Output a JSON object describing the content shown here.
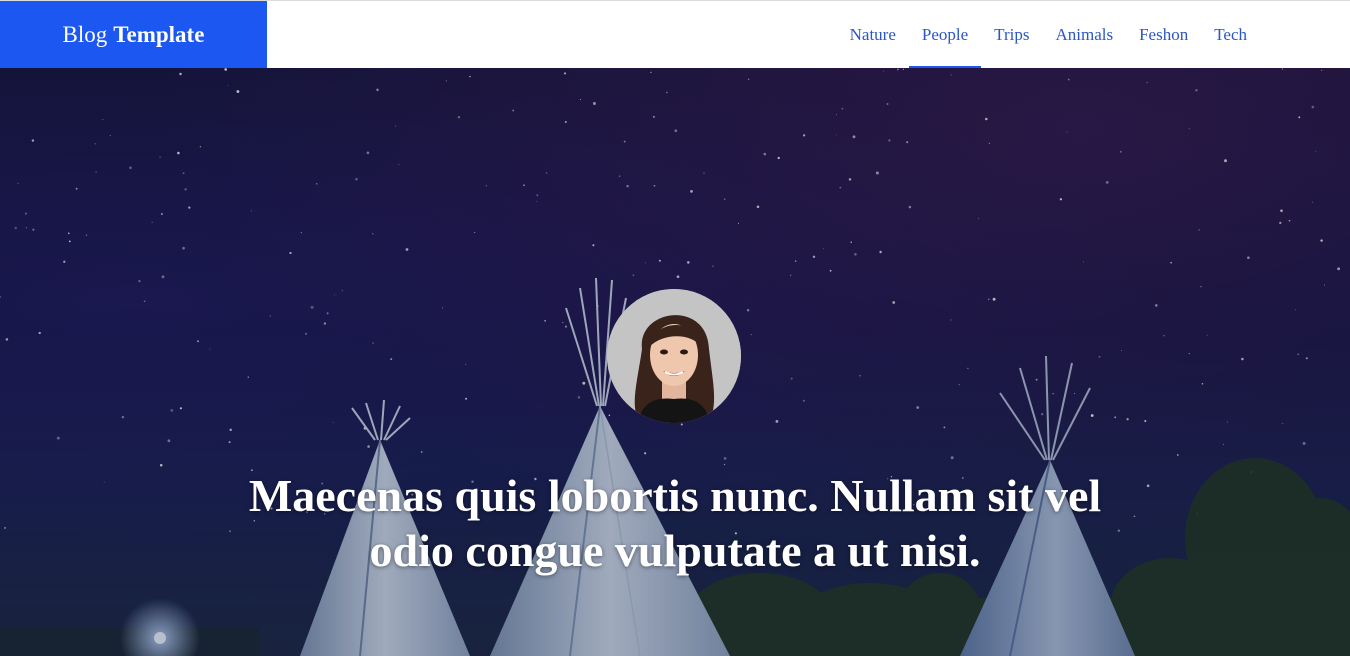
{
  "brand": {
    "part1": "Blog",
    "part2": "Template",
    "color": "#1b57f0"
  },
  "nav": {
    "items": [
      {
        "label": "Nature",
        "active": false
      },
      {
        "label": "People",
        "active": true
      },
      {
        "label": "Trips",
        "active": false
      },
      {
        "label": "Animals",
        "active": false
      },
      {
        "label": "Feshon",
        "active": false
      },
      {
        "label": "Tech",
        "active": false
      }
    ],
    "link_color": "#2a56c6"
  },
  "hero": {
    "title": "Maecenas quis lobortis nunc. Nullam sit vel odio congue vulputate a ut nisi.",
    "background": "night sky with teepee tents",
    "avatar_icon": "author-avatar"
  }
}
